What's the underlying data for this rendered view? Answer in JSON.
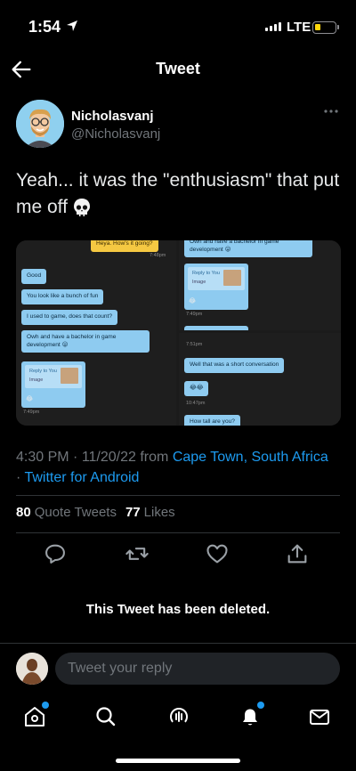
{
  "status_bar": {
    "time": "1:54",
    "network": "LTE",
    "battery_color": "#ffd60a"
  },
  "header": {
    "title": "Tweet",
    "back_icon": "arrow-left-icon"
  },
  "author": {
    "name": "Nicholasvanj",
    "handle": "@Nicholasvanj"
  },
  "tweet": {
    "text": "Yeah... it was the \"enthusiasm\" that put me off",
    "emoji": "skull-icon"
  },
  "media": {
    "left": {
      "top_bubble": "Heya. How's it going?",
      "top_time": "7:48pm",
      "bubbles": [
        "Good",
        "You look like a bunch of fun",
        "I used to game, does that count?",
        "Owh and have a bachelor in game development 😜"
      ],
      "reply_title": "Reply to You",
      "reply_sub": "Image",
      "reply_emoji": "😂",
      "bottom_time": "7:49pm"
    },
    "right_top": {
      "bubble": "Owh and have a bachelor in game development 😜",
      "reply_title": "Reply to You",
      "reply_sub": "Image",
      "reply_emoji": "😂",
      "time": "7:49pm"
    },
    "right_bottom": {
      "top_time": "7:51pm",
      "bubble": "Well that was a short conversation",
      "emoji_bubble": "😂😂",
      "time": "10:47pm",
      "cut_bubble": "How tall are you?"
    }
  },
  "meta": {
    "time": "4:30 PM",
    "date": "11/20/22",
    "from": "from",
    "location": "Cape Town, South Africa",
    "client": "Twitter for Android"
  },
  "stats": {
    "quotes_count": "80",
    "quotes_label": "Quote Tweets",
    "likes_count": "77",
    "likes_label": "Likes"
  },
  "deleted_notice": "This Tweet has been deleted.",
  "reply": {
    "placeholder": "Tweet your reply"
  },
  "accent_color": "#1d9bf0"
}
